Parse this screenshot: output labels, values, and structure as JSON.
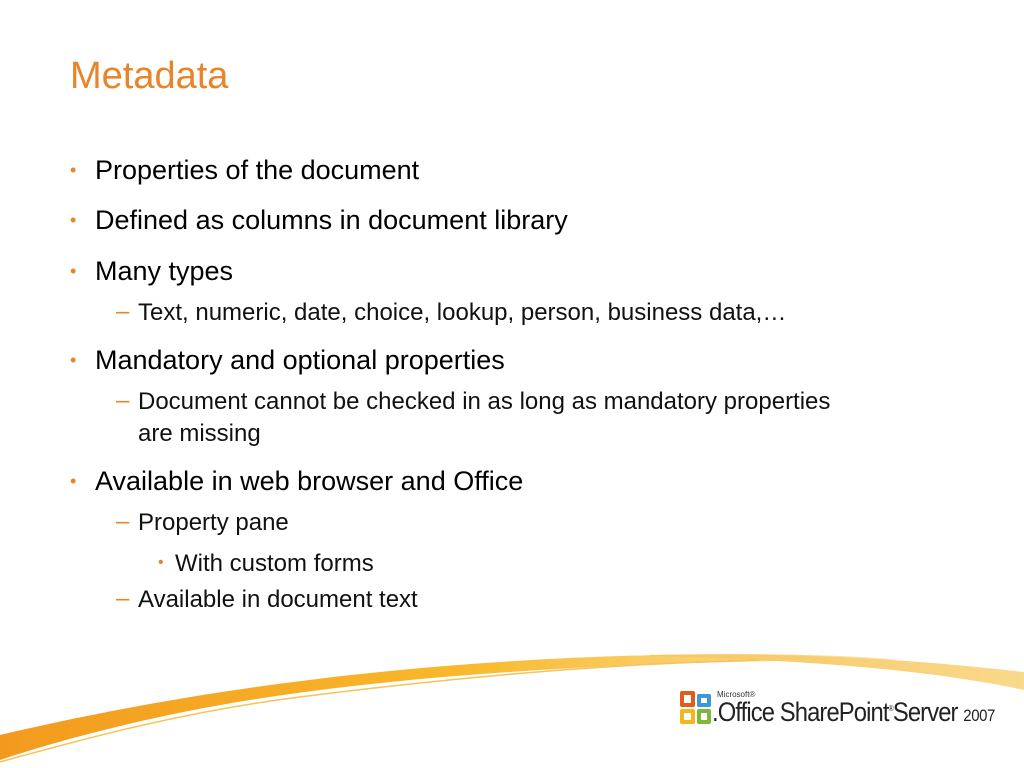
{
  "slide": {
    "title": "Metadata",
    "bullets": [
      {
        "text": "Properties of the document"
      },
      {
        "text": "Defined as columns in document library"
      },
      {
        "text": "Many types",
        "sub": [
          "Text, numeric, date, choice, lookup, person, business data,…"
        ]
      },
      {
        "text": "Mandatory and optional properties",
        "sub": [
          "Document cannot be checked in as long as mandatory properties",
          "are missing"
        ]
      },
      {
        "text": "Available in web browser and Office",
        "sub": [
          "Property pane",
          "Available in document text"
        ],
        "subsub": [
          "With custom forms"
        ]
      }
    ],
    "bullet_glyph": "•",
    "dash_glyph": "–"
  },
  "logo": {
    "icon": "office-logo-icon",
    "microsoft": "Microsoft®",
    "product": ".Office SharePoint",
    "tm": "®",
    "server": "Server",
    "year": "2007"
  },
  "colors": {
    "accent": "#E8842A",
    "swoosh_orange": "#F4A020",
    "swoosh_pale": "#F9D98A"
  }
}
